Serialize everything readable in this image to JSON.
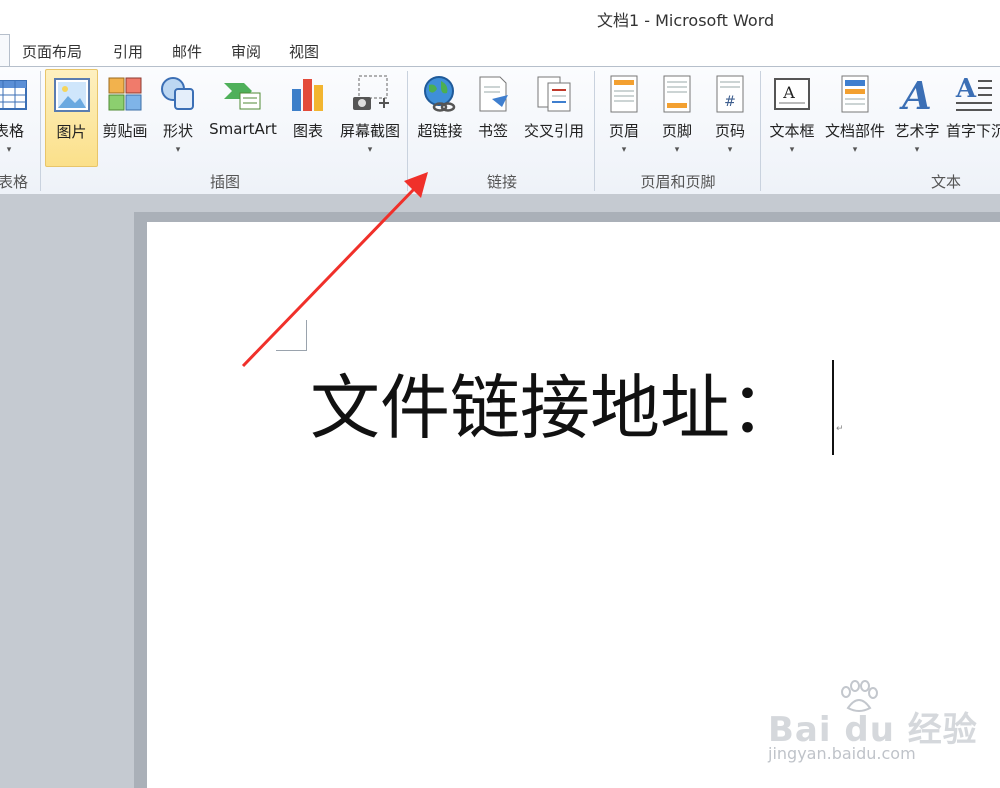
{
  "window": {
    "title": "文档1 - Microsoft Word"
  },
  "tabs": [
    "页面布局",
    "引用",
    "邮件",
    "审阅",
    "视图"
  ],
  "ribbon": {
    "groups": {
      "table": {
        "label": "表格",
        "buttons": {
          "table": "表格"
        }
      },
      "illustrations": {
        "label": "插图",
        "buttons": {
          "picture": "图片",
          "clipart": "剪贴画",
          "shapes": "形状",
          "smartart": "SmartArt",
          "chart": "图表",
          "screenshot": "屏幕截图"
        }
      },
      "links": {
        "label": "链接",
        "buttons": {
          "hyperlink": "超链接",
          "bookmark": "书签",
          "crossref": "交叉引用"
        }
      },
      "header_footer": {
        "label": "页眉和页脚",
        "buttons": {
          "header": "页眉",
          "footer": "页脚",
          "page_number": "页码"
        }
      },
      "text": {
        "label": "文本",
        "buttons": {
          "textbox": "文本框",
          "quickparts": "文档部件",
          "wordart": "艺术字",
          "dropcap": "首字下沉"
        }
      }
    },
    "dropdown_glyph": "▾",
    "icon_page_number_glyph": "#"
  },
  "document": {
    "text": "文件链接地址："
  },
  "watermark": {
    "brand": "Bai du 经验",
    "url": "jingyan.baidu.com"
  },
  "colors": {
    "arrow": "#f0302a",
    "active_button": "#fbe08a"
  }
}
